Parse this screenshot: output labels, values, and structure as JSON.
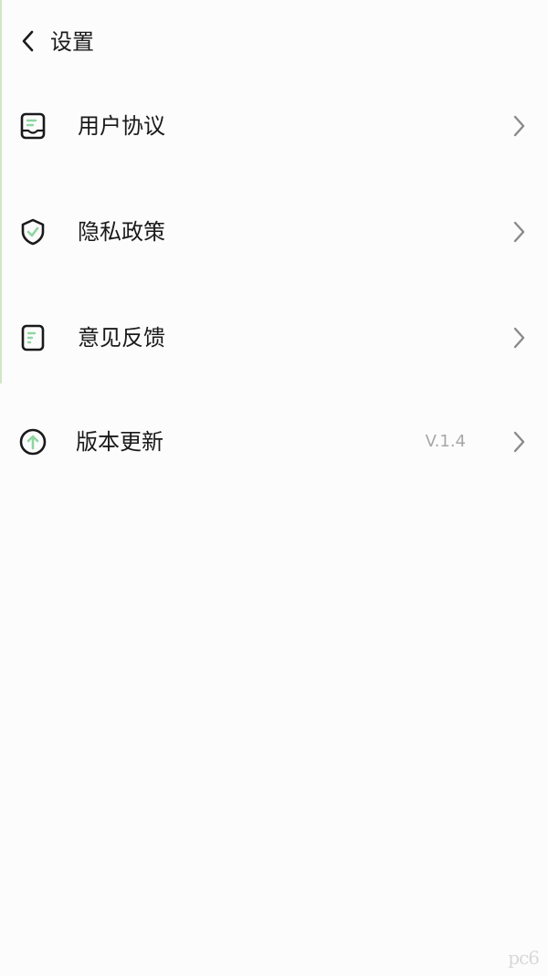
{
  "header": {
    "title": "设置",
    "back_icon": "chevron-left-icon"
  },
  "settings": [
    {
      "label": "用户协议",
      "icon": "document-icon",
      "value": ""
    },
    {
      "label": "隐私政策",
      "icon": "shield-check-icon",
      "value": ""
    },
    {
      "label": "意见反馈",
      "icon": "feedback-note-icon",
      "value": ""
    },
    {
      "label": "版本更新",
      "icon": "upgrade-arrow-icon",
      "value": "V.1.4"
    }
  ],
  "watermark": "pc6",
  "colors": {
    "accent_green": "#8fd6a1",
    "text": "#1a1a1a",
    "secondary": "#a7a7a7",
    "background": "#fcfcfc"
  }
}
